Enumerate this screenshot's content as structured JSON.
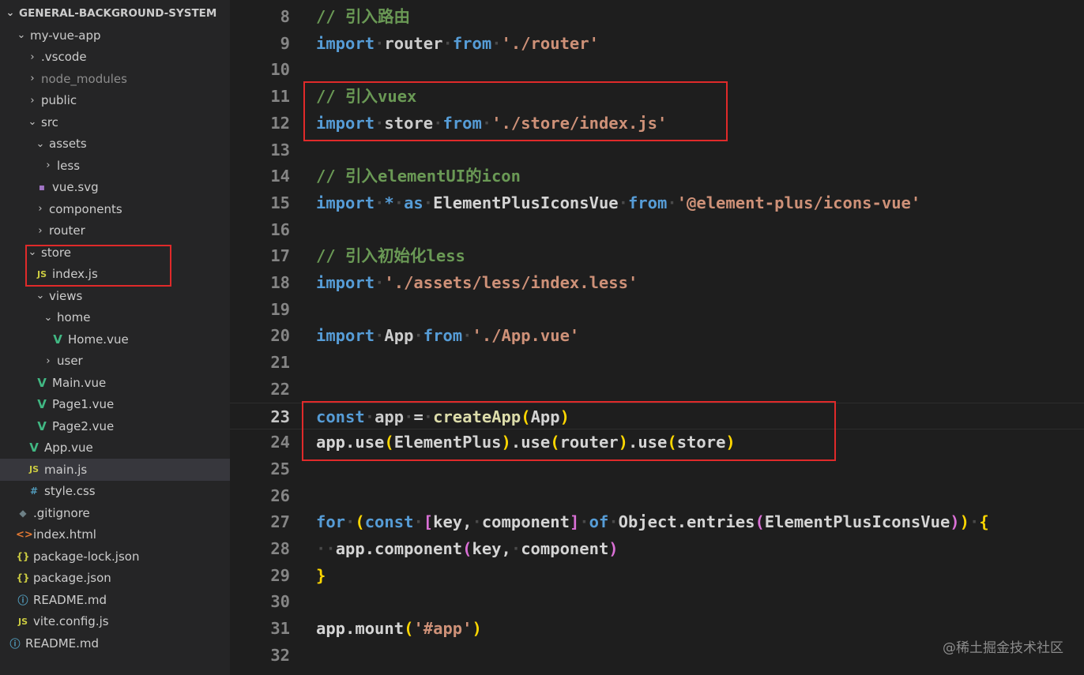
{
  "explorer": {
    "root_label": "GENERAL-BACKGROUND-SYSTEM",
    "items": [
      {
        "label": "my-vue-app",
        "chev": "⌄",
        "icon": "",
        "cls": ""
      },
      {
        "label": ".vscode",
        "chev": "›",
        "icon": "",
        "cls": ""
      },
      {
        "label": "node_modules",
        "chev": "›",
        "icon": "",
        "cls": "dim"
      },
      {
        "label": "public",
        "chev": "›",
        "icon": "",
        "cls": ""
      },
      {
        "label": "src",
        "chev": "⌄",
        "icon": "",
        "cls": ""
      },
      {
        "label": "assets",
        "chev": "⌄",
        "icon": "",
        "cls": ""
      },
      {
        "label": "less",
        "chev": "›",
        "icon": "",
        "cls": ""
      },
      {
        "label": "vue.svg",
        "chev": "",
        "icon": "svg",
        "cls": ""
      },
      {
        "label": "components",
        "chev": "›",
        "icon": "",
        "cls": ""
      },
      {
        "label": "router",
        "chev": "›",
        "icon": "",
        "cls": ""
      },
      {
        "label": "store",
        "chev": "⌄",
        "icon": "",
        "cls": ""
      },
      {
        "label": "index.js",
        "chev": "",
        "icon": "js",
        "cls": ""
      },
      {
        "label": "views",
        "chev": "⌄",
        "icon": "",
        "cls": ""
      },
      {
        "label": "home",
        "chev": "⌄",
        "icon": "",
        "cls": ""
      },
      {
        "label": "Home.vue",
        "chev": "",
        "icon": "vue",
        "cls": ""
      },
      {
        "label": "user",
        "chev": "›",
        "icon": "",
        "cls": ""
      },
      {
        "label": "Main.vue",
        "chev": "",
        "icon": "vue",
        "cls": ""
      },
      {
        "label": "Page1.vue",
        "chev": "",
        "icon": "vue",
        "cls": ""
      },
      {
        "label": "Page2.vue",
        "chev": "",
        "icon": "vue",
        "cls": ""
      },
      {
        "label": "App.vue",
        "chev": "",
        "icon": "vue",
        "cls": ""
      },
      {
        "label": "main.js",
        "chev": "",
        "icon": "js",
        "cls": "selected"
      },
      {
        "label": "style.css",
        "chev": "",
        "icon": "css",
        "cls": ""
      },
      {
        "label": ".gitignore",
        "chev": "",
        "icon": "git",
        "cls": ""
      },
      {
        "label": "index.html",
        "chev": "",
        "icon": "html",
        "cls": ""
      },
      {
        "label": "package-lock.json",
        "chev": "",
        "icon": "json",
        "cls": ""
      },
      {
        "label": "package.json",
        "chev": "",
        "icon": "json",
        "cls": ""
      },
      {
        "label": "README.md",
        "chev": "",
        "icon": "info",
        "cls": ""
      },
      {
        "label": "vite.config.js",
        "chev": "",
        "icon": "js",
        "cls": ""
      },
      {
        "label": "README.md",
        "chev": "",
        "icon": "info",
        "cls": ""
      }
    ],
    "icon_glyphs": {
      "js": "JS",
      "vue": "V",
      "css": "#",
      "json": "{}",
      "html": "<>",
      "info": "ⓘ",
      "git": "◆",
      "svg": "▪"
    }
  },
  "editor": {
    "current_line": 23,
    "lines": [
      {
        "n": "8",
        "tokens": [
          [
            "comment",
            "// 引入路由"
          ]
        ]
      },
      {
        "n": "9",
        "tokens": [
          [
            "kw",
            "import"
          ],
          [
            "sp",
            " "
          ],
          [
            "var",
            "router"
          ],
          [
            "sp",
            " "
          ],
          [
            "kw",
            "from"
          ],
          [
            "sp",
            " "
          ],
          [
            "str",
            "'./router'"
          ]
        ]
      },
      {
        "n": "10",
        "tokens": []
      },
      {
        "n": "11",
        "tokens": [
          [
            "comment",
            "// 引入vuex"
          ]
        ]
      },
      {
        "n": "12",
        "tokens": [
          [
            "kw",
            "import"
          ],
          [
            "sp",
            " "
          ],
          [
            "var",
            "store"
          ],
          [
            "sp",
            " "
          ],
          [
            "kw",
            "from"
          ],
          [
            "sp",
            " "
          ],
          [
            "str",
            "'./store/index.js'"
          ]
        ]
      },
      {
        "n": "13",
        "tokens": []
      },
      {
        "n": "14",
        "tokens": [
          [
            "comment",
            "// 引入elementUI的icon"
          ]
        ]
      },
      {
        "n": "15",
        "tokens": [
          [
            "kw",
            "import"
          ],
          [
            "sp",
            " "
          ],
          [
            "kw",
            "*"
          ],
          [
            "sp",
            " "
          ],
          [
            "kw",
            "as"
          ],
          [
            "sp",
            " "
          ],
          [
            "plain",
            "ElementPlusIconsVue"
          ],
          [
            "sp",
            " "
          ],
          [
            "kw",
            "from"
          ],
          [
            "sp",
            " "
          ],
          [
            "str",
            "'@element-plus/icons-vue'"
          ]
        ]
      },
      {
        "n": "16",
        "tokens": []
      },
      {
        "n": "17",
        "tokens": [
          [
            "comment",
            "// 引入初始化less"
          ]
        ]
      },
      {
        "n": "18",
        "tokens": [
          [
            "kw",
            "import"
          ],
          [
            "sp",
            " "
          ],
          [
            "str",
            "'./assets/less/index.less'"
          ]
        ]
      },
      {
        "n": "19",
        "tokens": []
      },
      {
        "n": "20",
        "tokens": [
          [
            "kw",
            "import"
          ],
          [
            "sp",
            " "
          ],
          [
            "var",
            "App"
          ],
          [
            "sp",
            " "
          ],
          [
            "kw",
            "from"
          ],
          [
            "sp",
            " "
          ],
          [
            "str",
            "'./App.vue'"
          ]
        ]
      },
      {
        "n": "21",
        "tokens": []
      },
      {
        "n": "22",
        "tokens": []
      },
      {
        "n": "23",
        "tokens": [
          [
            "kw",
            "const"
          ],
          [
            "sp",
            " "
          ],
          [
            "var",
            "app"
          ],
          [
            "sp",
            " "
          ],
          [
            "plain",
            "="
          ],
          [
            "sp",
            " "
          ],
          [
            "fn",
            "createApp"
          ],
          [
            "p1",
            "("
          ],
          [
            "plain",
            "App"
          ],
          [
            "p1",
            ")"
          ]
        ]
      },
      {
        "n": "24",
        "tokens": [
          [
            "plain",
            "app.use"
          ],
          [
            "p1",
            "("
          ],
          [
            "plain",
            "ElementPlus"
          ],
          [
            "p1",
            ")"
          ],
          [
            "plain",
            ".use"
          ],
          [
            "p1",
            "("
          ],
          [
            "plain",
            "router"
          ],
          [
            "p1",
            ")"
          ],
          [
            "plain",
            ".use"
          ],
          [
            "p1",
            "("
          ],
          [
            "plain",
            "store"
          ],
          [
            "p1",
            ")"
          ]
        ]
      },
      {
        "n": "25",
        "tokens": []
      },
      {
        "n": "26",
        "tokens": []
      },
      {
        "n": "27",
        "tokens": [
          [
            "ctrl",
            "for"
          ],
          [
            "sp",
            " "
          ],
          [
            "p1",
            "("
          ],
          [
            "kw",
            "const"
          ],
          [
            "sp",
            " "
          ],
          [
            "p2",
            "["
          ],
          [
            "plain",
            "key,"
          ],
          [
            "sp",
            " "
          ],
          [
            "plain",
            "component"
          ],
          [
            "p2",
            "]"
          ],
          [
            "sp",
            " "
          ],
          [
            "kw",
            "of"
          ],
          [
            "sp",
            " "
          ],
          [
            "plain",
            "Object.entries"
          ],
          [
            "p2",
            "("
          ],
          [
            "plain",
            "ElementPlusIconsVue"
          ],
          [
            "p2",
            ")"
          ],
          [
            "p1",
            ")"
          ],
          [
            "sp",
            " "
          ],
          [
            "p1",
            "{"
          ]
        ]
      },
      {
        "n": "28",
        "tokens": [
          [
            "sp",
            "  "
          ],
          [
            "plain",
            "app.component"
          ],
          [
            "p2",
            "("
          ],
          [
            "plain",
            "key,"
          ],
          [
            "sp",
            " "
          ],
          [
            "plain",
            "component"
          ],
          [
            "p2",
            ")"
          ]
        ]
      },
      {
        "n": "29",
        "tokens": [
          [
            "p1",
            "}"
          ]
        ]
      },
      {
        "n": "30",
        "tokens": []
      },
      {
        "n": "31",
        "tokens": [
          [
            "plain",
            "app.mount"
          ],
          [
            "p1",
            "("
          ],
          [
            "str",
            "'#app'"
          ],
          [
            "p1",
            ")"
          ]
        ]
      },
      {
        "n": "32",
        "tokens": []
      }
    ]
  },
  "watermark": "@稀土掘金技术社区"
}
